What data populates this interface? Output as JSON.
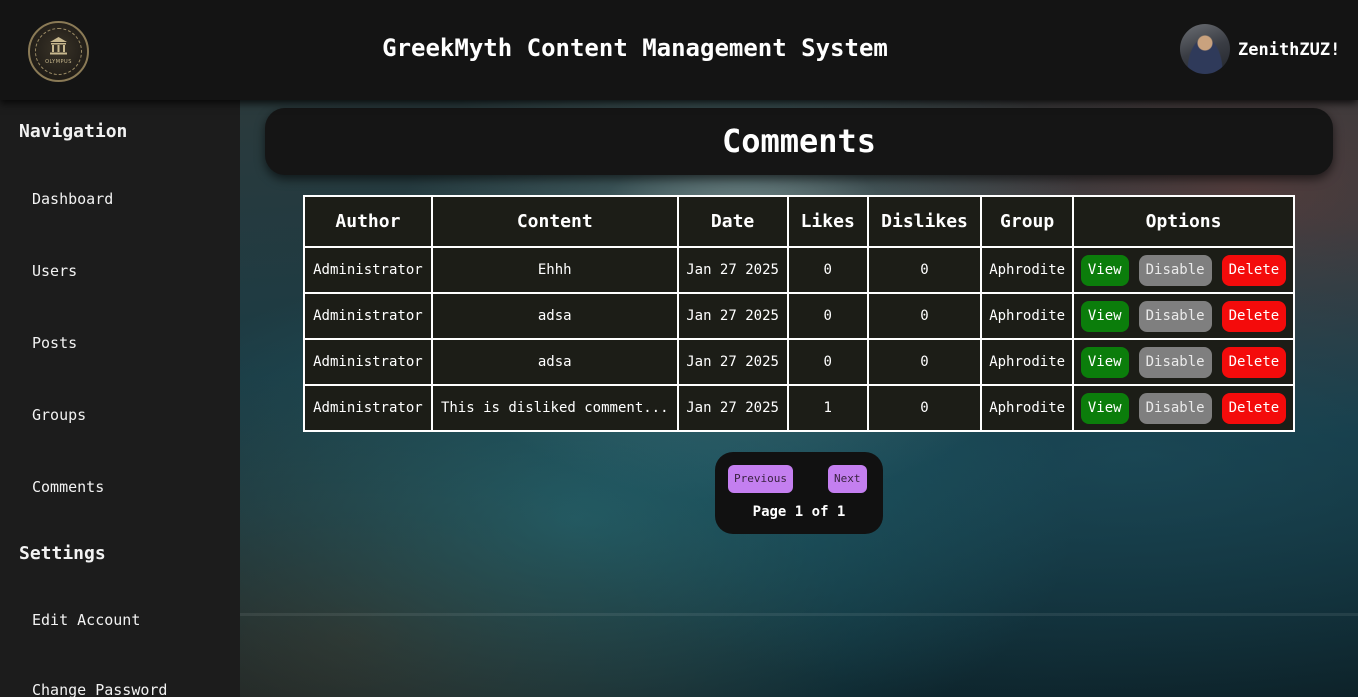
{
  "header": {
    "app_title": "GreekMyth Content Management System",
    "logo_text": "OLYMPUS",
    "username": "ZenithZUZ!"
  },
  "sidebar": {
    "nav_heading": "Navigation",
    "nav_items": [
      "Dashboard",
      "Users",
      "Posts",
      "Groups",
      "Comments"
    ],
    "settings_heading": "Settings",
    "settings_items": [
      "Edit Account",
      "Change Password"
    ]
  },
  "main": {
    "page_title": "Comments",
    "table": {
      "columns": [
        "Author",
        "Content",
        "Date",
        "Likes",
        "Dislikes",
        "Group",
        "Options"
      ],
      "rows": [
        {
          "author": "Administrator",
          "content": "Ehhh",
          "date": "Jan 27 2025",
          "likes": "0",
          "dislikes": "0",
          "group": "Aphrodite"
        },
        {
          "author": "Administrator",
          "content": "adsa",
          "date": "Jan 27 2025",
          "likes": "0",
          "dislikes": "0",
          "group": "Aphrodite"
        },
        {
          "author": "Administrator",
          "content": "adsa",
          "date": "Jan 27 2025",
          "likes": "0",
          "dislikes": "0",
          "group": "Aphrodite"
        },
        {
          "author": "Administrator",
          "content": "This is disliked comment...",
          "date": "Jan 27 2025",
          "likes": "1",
          "dislikes": "0",
          "group": "Aphrodite"
        }
      ],
      "option_labels": {
        "view": "View",
        "disable": "Disable",
        "delete": "Delete"
      }
    },
    "pagination": {
      "previous_label": "Previous",
      "next_label": "Next",
      "page_info": "Page 1 of 1"
    }
  },
  "colors": {
    "view_button": "#0b7d0b",
    "disable_button": "#7f7f7f",
    "delete_button": "#f40b0b",
    "pager_button": "#c47ff0"
  }
}
